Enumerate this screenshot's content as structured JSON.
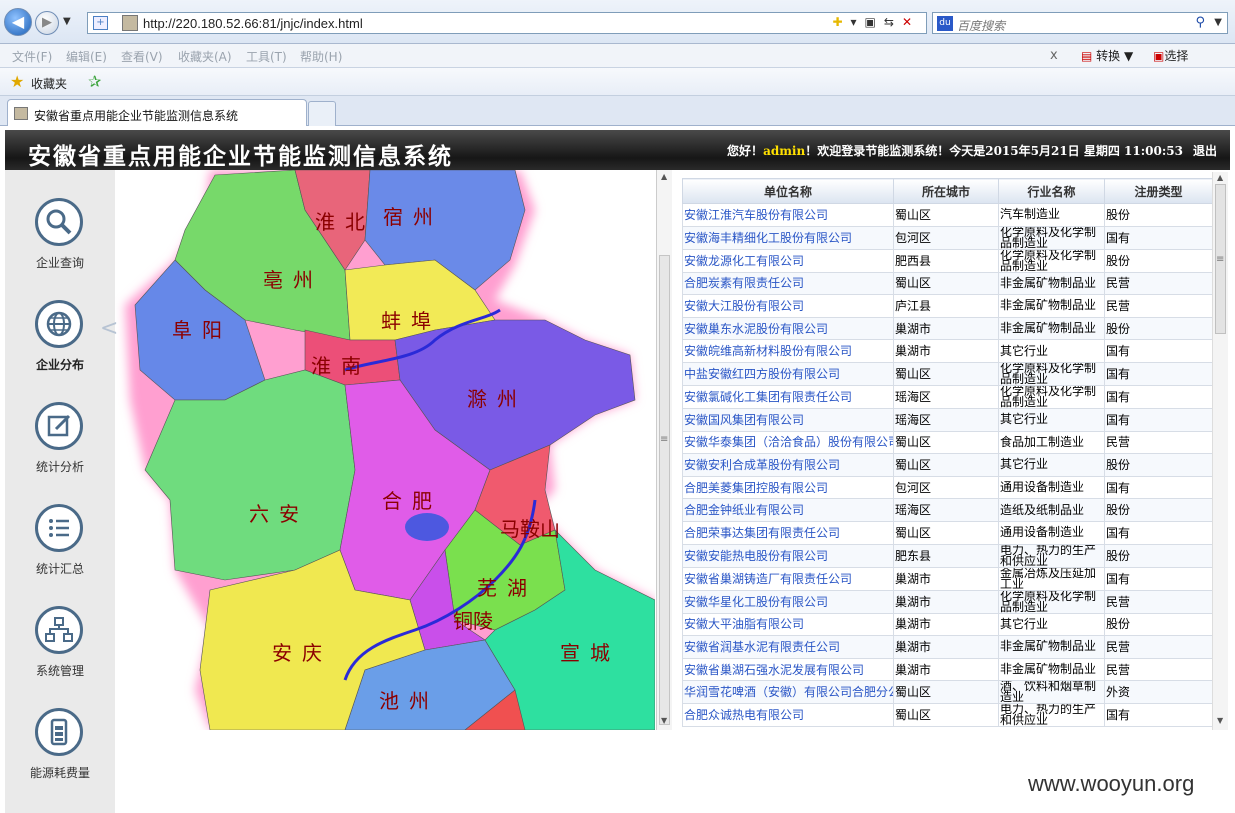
{
  "browser": {
    "url": "http://220.180.52.66:81/jnjc/index.html",
    "search_placeholder": "百度搜索",
    "menu": [
      "文件(F)",
      "编辑(E)",
      "查看(V)",
      "收藏夹(A)",
      "工具(T)",
      "帮助(H)"
    ],
    "convert_label": "转换",
    "select_label": "选择",
    "favorites_label": "收藏夹",
    "tab_title": "安徽省重点用能企业节能监测信息系统"
  },
  "header": {
    "title": "安徽省重点用能企业节能监测信息系统",
    "greeting": "您好！",
    "user": "admin",
    "welcome": "！欢迎登录节能监测系统！今天是2015年5月21日 星期四 11:00:53",
    "logout": "退出"
  },
  "sidebar": {
    "items": [
      {
        "label": "企业查询",
        "icon": "search-icon"
      },
      {
        "label": "企业分布",
        "icon": "globe-icon"
      },
      {
        "label": "统计分析",
        "icon": "edit-icon"
      },
      {
        "label": "统计汇总",
        "icon": "list-icon"
      },
      {
        "label": "系统管理",
        "icon": "org-chart-icon"
      },
      {
        "label": "能源耗费量",
        "icon": "battery-icon"
      }
    ]
  },
  "map": {
    "cities": [
      "淮北",
      "宿州",
      "亳州",
      "阜阳",
      "蚌埠",
      "淮南",
      "滁州",
      "六安",
      "合肥",
      "马鞍山",
      "芜湖",
      "铜陵",
      "安庆",
      "宣城",
      "池州"
    ]
  },
  "table": {
    "headers": [
      "单位名称",
      "所在城市",
      "行业名称",
      "注册类型"
    ],
    "rows": [
      [
        "安徽江淮汽车股份有限公司",
        "蜀山区",
        "汽车制造业",
        "股份"
      ],
      [
        "安徽海丰精细化工股份有限公司",
        "包河区",
        "化学原料及化学制品制造业",
        "国有"
      ],
      [
        "安徽龙源化工有限公司",
        "肥西县",
        "化学原料及化学制品制造业",
        "股份"
      ],
      [
        "合肥炭素有限责任公司",
        "蜀山区",
        "非金属矿物制品业",
        "民营"
      ],
      [
        "安徽大江股份有限公司",
        "庐江县",
        "非金属矿物制品业",
        "民营"
      ],
      [
        "安徽巢东水泥股份有限公司",
        "巢湖市",
        "非金属矿物制品业",
        "股份"
      ],
      [
        "安徽皖维高新材料股份有限公司",
        "巢湖市",
        "其它行业",
        "国有"
      ],
      [
        "中盐安徽红四方股份有限公司",
        "蜀山区",
        "化学原料及化学制品制造业",
        "国有"
      ],
      [
        "安徽氯碱化工集团有限责任公司",
        "瑶海区",
        "化学原料及化学制品制造业",
        "国有"
      ],
      [
        "安徽国风集团有限公司",
        "瑶海区",
        "其它行业",
        "国有"
      ],
      [
        "安徽华泰集团（洽洽食品）股份有限公司",
        "蜀山区",
        "食品加工制造业",
        "民营"
      ],
      [
        "安徽安利合成革股份有限公司",
        "蜀山区",
        "其它行业",
        "股份"
      ],
      [
        "合肥美菱集团控股有限公司",
        "包河区",
        "通用设备制造业",
        "国有"
      ],
      [
        "合肥金钟纸业有限公司",
        "瑶海区",
        "造纸及纸制品业",
        "股份"
      ],
      [
        "合肥荣事达集团有限责任公司",
        "蜀山区",
        "通用设备制造业",
        "国有"
      ],
      [
        "安徽安能热电股份有限公司",
        "肥东县",
        "电力、热力的生产和供应业",
        "股份"
      ],
      [
        "安徽省巢湖铸造厂有限责任公司",
        "巢湖市",
        "金属冶炼及压延加工业",
        "国有"
      ],
      [
        "安徽华星化工股份有限公司",
        "巢湖市",
        "化学原料及化学制品制造业",
        "民营"
      ],
      [
        "安徽大平油脂有限公司",
        "巢湖市",
        "其它行业",
        "股份"
      ],
      [
        "安徽省润基水泥有限责任公司",
        "巢湖市",
        "非金属矿物制品业",
        "民营"
      ],
      [
        "安徽省巢湖石强水泥发展有限公司",
        "巢湖市",
        "非金属矿物制品业",
        "民营"
      ],
      [
        "华润雪花啤酒（安徽）有限公司合肥分公司",
        "蜀山区",
        "酒、饮料和烟草制造业",
        "外资"
      ],
      [
        "合肥众诚热电有限公司",
        "蜀山区",
        "电力、热力的生产和供应业",
        "国有"
      ]
    ]
  },
  "watermark": "www.wooyun.org"
}
